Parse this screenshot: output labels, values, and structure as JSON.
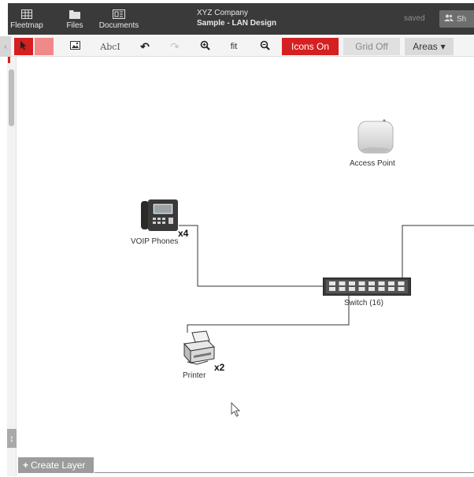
{
  "header": {
    "nav": [
      {
        "label": "Fleetmap",
        "icon": "grid-icon"
      },
      {
        "label": "Files",
        "icon": "folder-icon"
      },
      {
        "label": "Documents",
        "icon": "documents-icon"
      }
    ],
    "company": "XYZ Company",
    "project": "Sample - LAN Design",
    "status": "saved",
    "share_label": "Sh"
  },
  "toolbar": {
    "select_icon": "cursor-icon",
    "pan_icon": "pan-icon",
    "image_icon": "image-icon",
    "text_label": "AbcI",
    "undo_icon": "undo-icon",
    "redo_icon": "redo-icon",
    "zoom_in_icon": "zoom-in-icon",
    "fit_label": "fit",
    "zoom_out_icon": "zoom-out-icon",
    "icons_toggle": "Icons On",
    "grid_toggle": "Grid Off",
    "areas_label": "Areas"
  },
  "canvas": {
    "devices": [
      {
        "label": "Access Point",
        "icon": "access-point-icon"
      },
      {
        "label": "VOIP Phones",
        "icon": "voip-phone-icon",
        "quantity": "x4"
      },
      {
        "label": "Switch (16)",
        "icon": "network-switch-icon"
      },
      {
        "label": "Printer",
        "icon": "printer-icon",
        "quantity": "x2"
      }
    ]
  },
  "layers": {
    "create_label": "Create Layer"
  },
  "colors": {
    "accent": "#d42020",
    "header_bg": "#3a3a3a",
    "toolbar_bg": "#f4f4f4"
  }
}
